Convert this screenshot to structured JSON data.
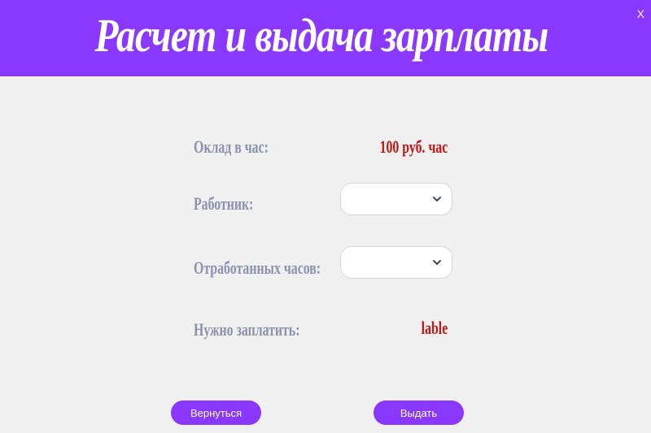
{
  "window": {
    "title": "Расчет и выдача зарплаты",
    "close_label": "X"
  },
  "form": {
    "rate": {
      "label": "Оклад в час:",
      "value": "100 руб. час"
    },
    "employee": {
      "label": "Работник:",
      "selected": ""
    },
    "hours": {
      "label": "Отработанных часов:",
      "selected": ""
    },
    "to_pay": {
      "label": "Нужно заплатить:",
      "value": "lable"
    }
  },
  "buttons": {
    "back_label": "Вернуться",
    "pay_label": "Выдать"
  },
  "colors": {
    "accent": "#8a37ff",
    "label": "#8a92ad",
    "value": "#c41515",
    "background": "#f0f0f0"
  }
}
